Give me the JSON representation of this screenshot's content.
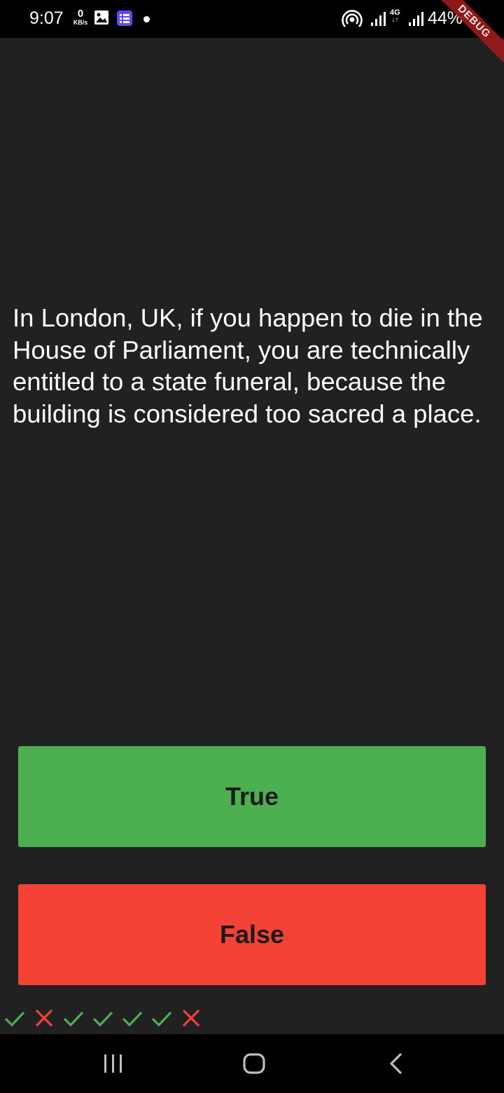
{
  "status_bar": {
    "time": "9:07",
    "net_speed_value": "0",
    "net_speed_unit": "KB/s",
    "network_type": "4G",
    "battery": "44%",
    "icons": [
      "gallery-icon",
      "app-notification-icon",
      "dot-icon",
      "hotspot-icon",
      "signal-icon",
      "signal-icon",
      "battery-icon"
    ]
  },
  "debug_banner": "DEBUG",
  "question": {
    "text": "In London, UK, if you happen to die in the House of Parliament, you are technically entitled to a state funeral, because the building is considered too sacred a place."
  },
  "buttons": {
    "true_label": "True",
    "false_label": "False"
  },
  "score": {
    "marks": [
      "check",
      "cross",
      "check",
      "check",
      "check",
      "check",
      "cross"
    ]
  },
  "nav": {
    "icons": [
      "recents-icon",
      "home-icon",
      "back-icon"
    ]
  },
  "colors": {
    "background": "#212121",
    "true_button": "#4caf50",
    "false_button": "#f44336",
    "check": "#4caf50",
    "cross": "#f44336",
    "debug_banner": "#a01a1a"
  }
}
